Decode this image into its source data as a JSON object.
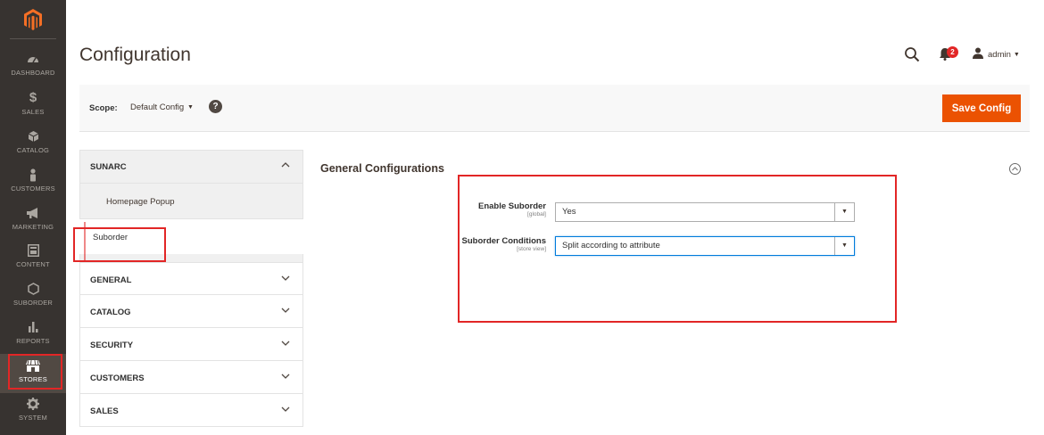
{
  "sidebar": {
    "items": [
      {
        "label": "DASHBOARD",
        "icon": "dashboard-gauge-icon"
      },
      {
        "label": "SALES",
        "icon": "dollar-icon"
      },
      {
        "label": "CATALOG",
        "icon": "cube-icon"
      },
      {
        "label": "CUSTOMERS",
        "icon": "person-icon"
      },
      {
        "label": "MARKETING",
        "icon": "megaphone-icon"
      },
      {
        "label": "CONTENT",
        "icon": "content-layout-icon"
      },
      {
        "label": "SUBORDER",
        "icon": "hexagon-icon"
      },
      {
        "label": "REPORTS",
        "icon": "bar-chart-icon"
      },
      {
        "label": "STORES",
        "icon": "store-icon"
      },
      {
        "label": "SYSTEM",
        "icon": "gear-icon"
      }
    ],
    "active": "STORES"
  },
  "header": {
    "title": "Configuration",
    "notifications_count": "2",
    "user_name": "admin"
  },
  "scope": {
    "label": "Scope:",
    "value": "Default Config",
    "help_glyph": "?",
    "save_label": "Save Config"
  },
  "tabs": {
    "group_title": "SUNARC",
    "sub_items": [
      "Homepage Popup",
      "Suborder"
    ],
    "active_sub": "Suborder",
    "sections": [
      "GENERAL",
      "CATALOG",
      "SECURITY",
      "CUSTOMERS",
      "SALES"
    ]
  },
  "main": {
    "section_title": "General Configurations",
    "fields": [
      {
        "label": "Enable Suborder",
        "scope": "[global]",
        "value": "Yes"
      },
      {
        "label": "Suborder Conditions",
        "scope": "[store view]",
        "value": "Split according to attribute"
      }
    ]
  },
  "colors": {
    "sidebar_bg": "#373330",
    "accent": "#eb5202",
    "highlight": "#e22626"
  }
}
